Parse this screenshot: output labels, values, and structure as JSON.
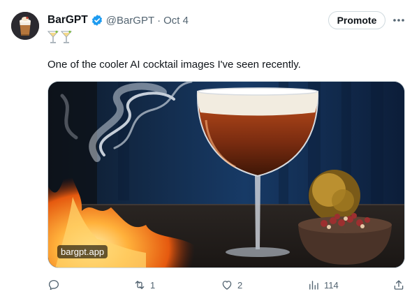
{
  "account": {
    "name": "BarGPT",
    "handle": "@BarGPT",
    "separator": "·",
    "date": "Oct 4",
    "verified_color": "#1d9bf0",
    "bio_icons": [
      "cocktail-glass-icon",
      "cocktail-glass-icon"
    ]
  },
  "header_actions": {
    "promote_label": "Promote",
    "more_label": "···"
  },
  "tweet": {
    "text": "One of the cooler AI cocktail images I've seen recently."
  },
  "media": {
    "watermark": "bargpt.app",
    "description_icon": "cocktail-photo-image"
  },
  "engagement": {
    "replies": "",
    "retweets": "1",
    "likes": "2",
    "views": "114"
  },
  "colors": {
    "text_primary": "#0f1419",
    "text_secondary": "#536471",
    "border": "#cfd9de"
  }
}
